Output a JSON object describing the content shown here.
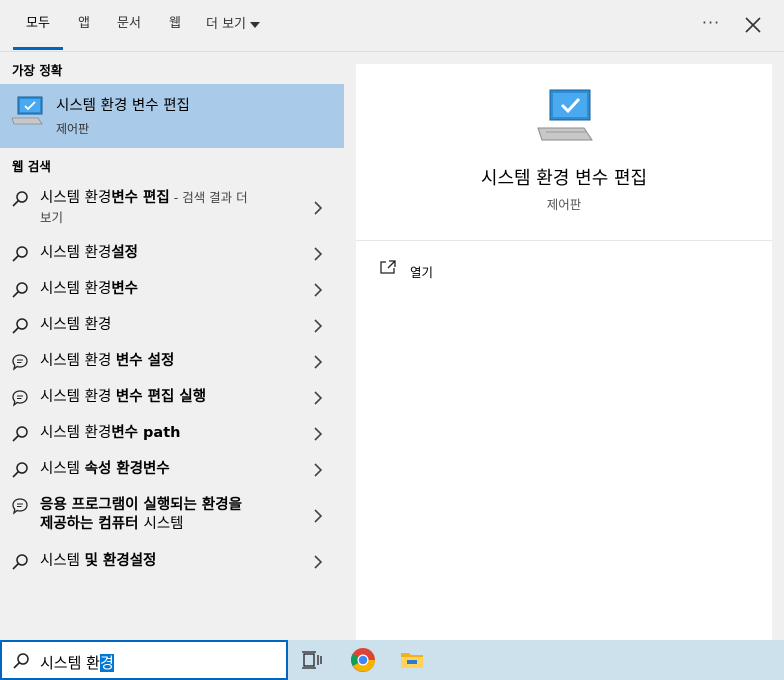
{
  "tabs": [
    {
      "label": "모두",
      "active": true
    },
    {
      "label": "앱"
    },
    {
      "label": "문서"
    },
    {
      "label": "웹"
    },
    {
      "label": "더 보기"
    }
  ],
  "topbar": {
    "more_options_icon": "ellipsis-icon",
    "close_icon": "close-icon"
  },
  "best_match": {
    "heading": "가장 정확",
    "title": "시스템 환경 변수 편집",
    "subtitle": "제어판",
    "icon": "computer-check-icon"
  },
  "web_search": {
    "heading": "웹 검색",
    "items": [
      {
        "icon": "search-icon",
        "plain": "시스템 환경",
        "bold": "변수 편집",
        "extra": " - 검색 결과 더",
        "line2": "보기"
      },
      {
        "icon": "search-icon",
        "plain": "시스템 환경",
        "bold": "설정"
      },
      {
        "icon": "search-icon",
        "plain": "시스템 환경",
        "bold": "변수"
      },
      {
        "icon": "search-icon",
        "plain": "시스템 환경",
        "bold": ""
      },
      {
        "icon": "chat-bubble-icon",
        "plain": "시스템 환경 ",
        "bold": "변수 설정"
      },
      {
        "icon": "chat-bubble-icon",
        "plain": "시스템 환경 ",
        "bold": "변수 편집 실행"
      },
      {
        "icon": "search-icon",
        "plain": "시스템 환경",
        "bold": "변수 path"
      },
      {
        "icon": "search-icon",
        "plain": "시스템 ",
        "bold": "속성 환경변수"
      },
      {
        "icon": "chat-bubble-icon",
        "bold": "응용 프로그램이 실행되는 환경을",
        "bold2": "제공하는 컴퓨터 ",
        "plain2": "시스템"
      },
      {
        "icon": "search-icon",
        "plain": "시스템 ",
        "bold": "및 환경설정"
      }
    ]
  },
  "preview": {
    "title": "시스템 환경 변수 편집",
    "subtitle": "제어판",
    "open_label": "열기"
  },
  "taskbar": {
    "search_text": "시스템 환",
    "search_selected": "경",
    "apps": [
      "task-view-icon",
      "chrome-icon",
      "file-explorer-icon"
    ]
  },
  "colors": {
    "accent": "#0067c0",
    "selected_bg": "#a9cbe9",
    "taskbar_bg": "#cce1ec"
  }
}
